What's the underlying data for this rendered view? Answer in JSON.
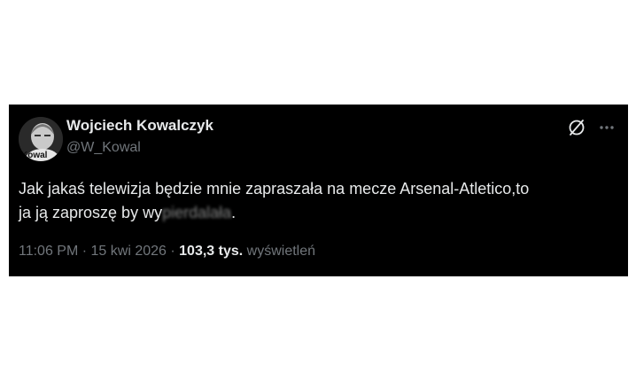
{
  "author": {
    "name": "Wojciech Kowalczyk",
    "handle": "@W_Kowal",
    "avatar_caption": "Kowal"
  },
  "tweet": {
    "line1": "Jak jakaś telewizja będzie mnie zapraszała na mecze Arsenal-Atletico,to",
    "line2_prefix": "ja ją zaproszę by wy",
    "line2_blurred": "pierdalała",
    "line2_suffix": "."
  },
  "meta": {
    "time": "11:06 PM",
    "separator": "·",
    "date": "15 kwi 2026",
    "views_count": "103,3 tys.",
    "views_label": "wyświetleń"
  },
  "icons": {
    "grok": "grok-icon",
    "more": "more-horizontal-icon"
  },
  "colors": {
    "card_bg": "#000000",
    "primary_text": "#e7e9ea",
    "secondary_text": "#71767b"
  }
}
